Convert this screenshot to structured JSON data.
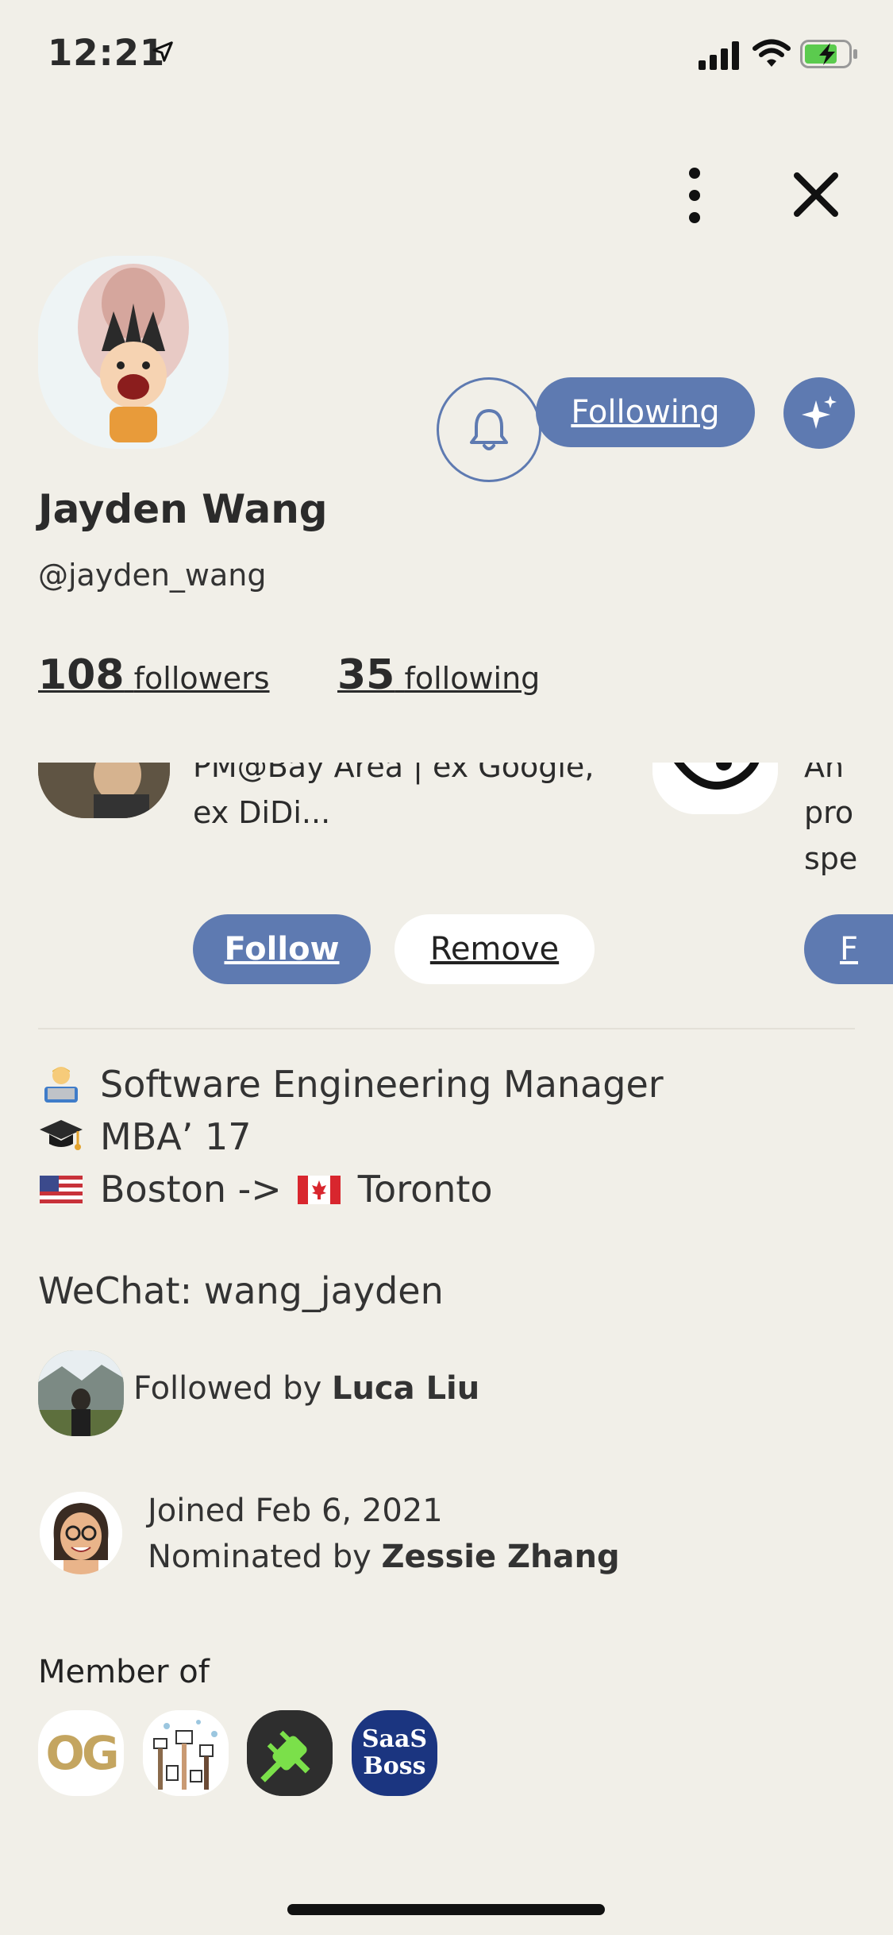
{
  "status_bar": {
    "time": "12:21"
  },
  "profile": {
    "name": "Jayden Wang",
    "handle": "@jayden_wang",
    "followers_count": "108",
    "followers_label": "followers",
    "following_count": "35",
    "following_label": "following",
    "following_button": "Following"
  },
  "suggestions": {
    "first": {
      "bio_line1": "PM@Bay Area | ex Google,",
      "bio_line2": "ex DiDi...",
      "follow_label": "Follow",
      "remove_label": "Remove"
    },
    "second": {
      "bio_line1": "An",
      "bio_line2": "pro",
      "bio_line3": "spe",
      "follow_label": "F"
    }
  },
  "bio": {
    "line1": "Software Engineering Manager",
    "line2": "MBA’ 17",
    "line3_a": "Boston ->",
    "line3_b": "Toronto",
    "wechat": "WeChat: wang_jayden"
  },
  "followed_by": {
    "prefix": "Followed by ",
    "name": "Luca Liu"
  },
  "joined": {
    "date_text": "Joined Feb 6, 2021",
    "nominated_prefix": "Nominated by ",
    "nominated_name": "Zessie Zhang"
  },
  "member_of": {
    "label": "Member of",
    "clubs": [
      {
        "icon": "og-club-icon",
        "text": "OG"
      },
      {
        "icon": "illustration-club-icon"
      },
      {
        "icon": "plug-club-icon"
      },
      {
        "icon": "saas-boss-club-icon",
        "line1": "SaaS",
        "line2": "Boss"
      }
    ]
  },
  "colors": {
    "accent": "#5E7AB1",
    "background": "#F1EFE8"
  }
}
